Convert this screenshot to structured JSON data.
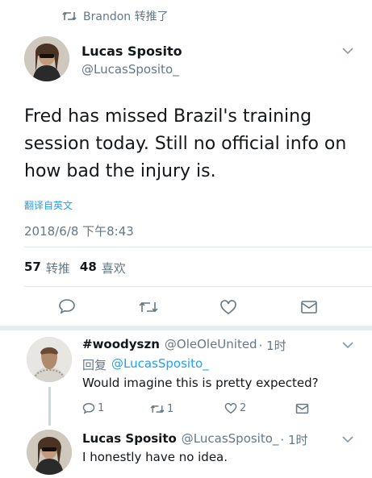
{
  "retweet_header": {
    "text": "Brandon 转推了",
    "icon": "retweet-icon"
  },
  "main_tweet": {
    "author_name": "Lucas Sposito",
    "author_handle": "@LucasSposito_",
    "text": "Fred has missed Brazil's training session today. Still no official info on how bad the injury is.",
    "translate_label": "翻译自英文",
    "timestamp": "2018/6/8 下午8:43",
    "retweet_count": "57",
    "retweet_label": "转推",
    "like_count": "48",
    "like_label": "喜欢",
    "actions": [
      "reply-icon",
      "retweet-icon",
      "like-icon",
      "message-icon"
    ]
  },
  "replies": [
    {
      "author_name": "#woodyszn",
      "author_handle": "@OleOleUnited",
      "time": "· 1时",
      "reply_prefix": "回复",
      "reply_to": "@LucasSposito_",
      "text": "Would imagine this is pretty expected?",
      "reply_count": "1",
      "retweet_count": "1",
      "like_count": "2"
    },
    {
      "author_name": "Lucas Sposito",
      "author_handle": "@LucasSposito_",
      "time": "· 1时",
      "text": "I honestly have no idea."
    }
  ],
  "colors": {
    "accent": "#1da1f2",
    "muted": "#657786",
    "divider": "#e1e8ed"
  }
}
